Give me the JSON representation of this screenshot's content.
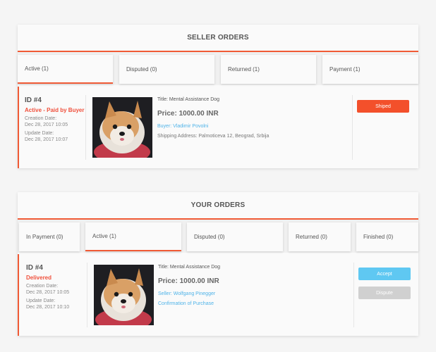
{
  "seller": {
    "title": "SELLER ORDERS",
    "tabs": [
      {
        "label": "Active (1)"
      },
      {
        "label": "Disputed (0)"
      },
      {
        "label": "Returned (1)"
      },
      {
        "label": "Payment (1)"
      }
    ],
    "order": {
      "id": "ID #4",
      "status": "Active - Paid by Buyer",
      "creation_label": "Creation Date:",
      "creation_date": "Dec 28, 2017 10:05",
      "update_label": "Update Date:",
      "update_date": "Dec 28, 2017 10:07",
      "item_title": "Title: Mental Assistance Dog",
      "price": "Price: 1000.00 INR",
      "buyer": "Buyer: Vladimir Povolni",
      "shipping": "Shipping Address: Palmoticeva 12, Beograd, Srbija",
      "action": "Shiped"
    }
  },
  "yours": {
    "title": "YOUR ORDERS",
    "tabs": [
      {
        "label": "In Payment (0)"
      },
      {
        "label": "Active (1)"
      },
      {
        "label": "Disputed (0)"
      },
      {
        "label": "Returned (0)"
      },
      {
        "label": "Finished (0)"
      }
    ],
    "order": {
      "id": "ID #4",
      "status": "Delivered",
      "creation_label": "Creation Date:",
      "creation_date": "Dec 28, 2017 10:05",
      "update_label": "Update Date:",
      "update_date": "Dec 28, 2017 10:10",
      "item_title": "Title: Mental Assistance Dog",
      "price": "Price: 1000.00 INR",
      "seller": "Seller: Wolfgang Pinegger",
      "confirm": "Confirmation of Purchase",
      "accept": "Accept",
      "dispute": "Dispute"
    }
  },
  "colors": {
    "accent": "#f05a35",
    "link": "#4fb3e8",
    "accept": "#5fc8f2",
    "dispute": "#d0d0d0"
  }
}
